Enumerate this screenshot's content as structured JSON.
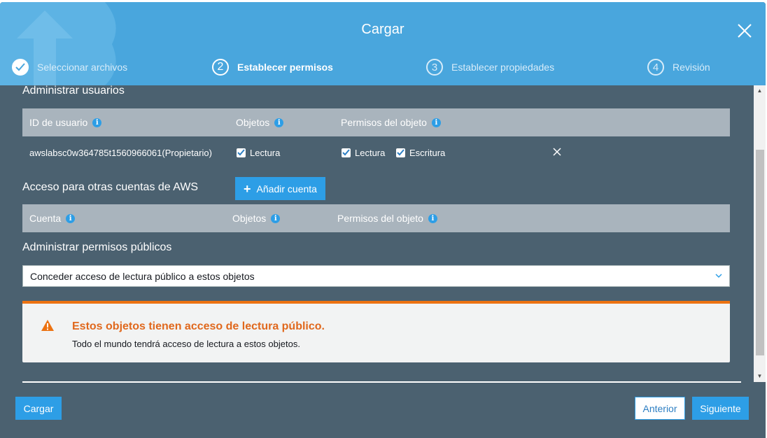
{
  "modal": {
    "title": "Cargar",
    "steps": [
      {
        "num": "",
        "label": "Seleccionar archivos",
        "state": "done"
      },
      {
        "num": "2",
        "label": "Establecer permisos",
        "state": "active"
      },
      {
        "num": "3",
        "label": "Establecer propiedades",
        "state": "pending"
      },
      {
        "num": "4",
        "label": "Revisión",
        "state": "pending"
      }
    ]
  },
  "users": {
    "title": "Administrar usuarios",
    "columns": [
      "ID de usuario",
      "Objetos",
      "Permisos del objeto"
    ],
    "row": {
      "user_id": "awslabsc0w364785t1560966061(Propietario)",
      "objects_read": "Lectura",
      "perm_read": "Lectura",
      "perm_write": "Escritura"
    }
  },
  "accounts": {
    "title": "Acceso para otras cuentas de AWS",
    "add_button": "Añadir cuenta",
    "columns": [
      "Cuenta",
      "Objetos",
      "Permisos del objeto"
    ]
  },
  "public": {
    "title": "Administrar permisos públicos",
    "select_value": "Conceder acceso de lectura público a estos objetos"
  },
  "warning": {
    "title": "Estos objetos tienen acceso de lectura público.",
    "text": "Todo el mundo tendrá acceso de lectura a estos objetos."
  },
  "footer": {
    "upload": "Cargar",
    "previous": "Anterior",
    "next": "Siguiente"
  },
  "colors": {
    "header": "#49a6dd",
    "body": "#4b6170",
    "accent": "#2d9ee6",
    "warning": "#ec7211"
  }
}
